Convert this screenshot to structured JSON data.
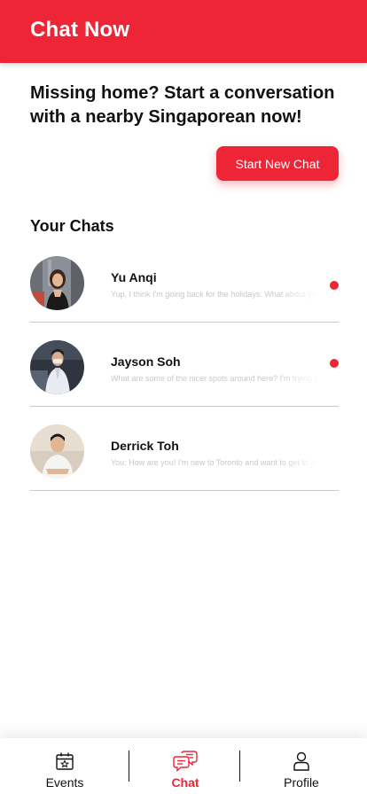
{
  "header": {
    "title": "Chat Now"
  },
  "intro": {
    "text": "Missing home? Start a conversation with a nearby Singaporean now!"
  },
  "start_button": {
    "label": "Start New Chat"
  },
  "chats_section": {
    "title": "Your Chats"
  },
  "chats": [
    {
      "name": "Yu Anqi",
      "preview": "Yup, I think I'm going back for the holidays. What about you?",
      "unread": true
    },
    {
      "name": "Jayson Soh",
      "preview": "What are some of the nicer spots around here? I'm trying to explore",
      "unread": true
    },
    {
      "name": "Derrick Toh",
      "preview": "You: How are you! I'm new to Toronto and want to get to know people",
      "unread": false
    }
  ],
  "nav": {
    "items": [
      {
        "label": "Events",
        "icon": "calendar-star-icon",
        "active": false
      },
      {
        "label": "Chat",
        "icon": "chat-bubbles-icon",
        "active": true
      },
      {
        "label": "Profile",
        "icon": "person-icon",
        "active": false
      }
    ]
  },
  "colors": {
    "accent": "#ee2536",
    "text": "#111111",
    "muted_text": "#c8c8c8",
    "divider": "#c9c9c9"
  }
}
